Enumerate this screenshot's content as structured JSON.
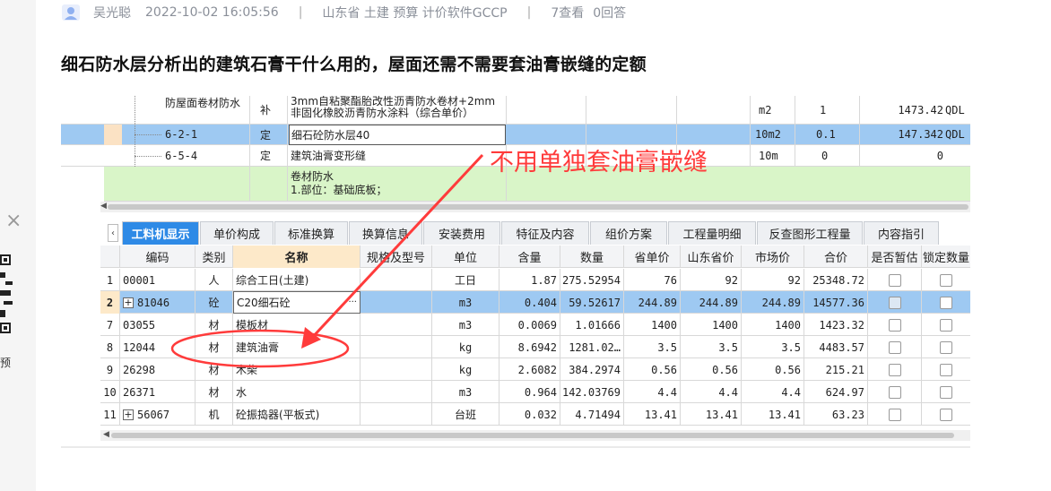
{
  "post": {
    "author": "吴光聪",
    "datetime": "2022-10-02 16:05:56",
    "tags": "山东省  土建  预算  计价软件GCCP",
    "views": "7查看",
    "answers": "0回答",
    "title": "细石防水层分析出的建筑石膏干什么用的，屋面还需不需要套油膏嵌缝的定额"
  },
  "side": {
    "close_glyph": "×",
    "text": "预"
  },
  "annotation": {
    "text": "不用单独套油膏嵌缝",
    "color": "#ff3b3b"
  },
  "upper_rows": [
    {
      "code": "防屋面卷材防水",
      "type": "补",
      "name": "3mm自粘聚酯胎改性沥青防水卷材+2mm非固化橡胶沥青防水涂料（综合单价）",
      "unit": "m2",
      "qty": "1",
      "total": "1473.42",
      "tag": "QDL"
    },
    {
      "code": "6-2-1",
      "type": "定",
      "name": "细石砼防水层40",
      "unit": "10m2",
      "qty": "0.1",
      "total": "147.342",
      "tag": "QDL"
    },
    {
      "code": "6-5-4",
      "type": "定",
      "name": "建筑油膏变形缝",
      "unit": "10m",
      "qty": "0",
      "total": "0",
      "tag": ""
    },
    {
      "code": "",
      "type": "",
      "name": "卷材防水",
      "name2": "1.部位：基础底板；",
      "unit": "",
      "qty": "",
      "total": "",
      "tag": ""
    }
  ],
  "tabs": [
    {
      "label": "工料机显示",
      "active": true
    },
    {
      "label": "单价构成"
    },
    {
      "label": "标准换算"
    },
    {
      "label": "换算信息"
    },
    {
      "label": "安装费用"
    },
    {
      "label": "特征及内容"
    },
    {
      "label": "组价方案"
    },
    {
      "label": "工程量明细"
    },
    {
      "label": "反查图形工程量"
    },
    {
      "label": "内容指引"
    }
  ],
  "grid": {
    "headers": [
      "",
      "编码",
      "类别",
      "名称",
      "规格及型号",
      "单位",
      "含量",
      "数量",
      "省单价",
      "山东省价",
      "市场价",
      "合价",
      "是否暂估",
      "锁定数量"
    ],
    "rows": [
      {
        "no": "1",
        "code": "00001",
        "cat": "人",
        "name": "综合工日(土建)",
        "spec": "",
        "unit": "工日",
        "content": "1.87",
        "qty": "275.52954",
        "prov": "76",
        "sd": "92",
        "market": "92",
        "total": "25348.72",
        "expand": false,
        "sel": false
      },
      {
        "no": "2",
        "code": "81046",
        "cat": "砼",
        "name": "C20细石砼",
        "spec": "",
        "unit": "m3",
        "content": "0.404",
        "qty": "59.52617",
        "prov": "244.89",
        "sd": "244.89",
        "market": "244.89",
        "total": "14577.36",
        "expand": true,
        "sel": true
      },
      {
        "no": "7",
        "code": "03055",
        "cat": "材",
        "name": "模板材",
        "spec": "",
        "unit": "m3",
        "content": "0.0069",
        "qty": "1.01666",
        "prov": "1400",
        "sd": "1400",
        "market": "1400",
        "total": "1423.32",
        "expand": false,
        "sel": false
      },
      {
        "no": "8",
        "code": "12044",
        "cat": "材",
        "name": "建筑油膏",
        "spec": "",
        "unit": "kg",
        "content": "8.6942",
        "qty": "1281.02…",
        "prov": "3.5",
        "sd": "3.5",
        "market": "3.5",
        "total": "4483.57",
        "expand": false,
        "sel": false
      },
      {
        "no": "9",
        "code": "26298",
        "cat": "材",
        "name": "木柴",
        "spec": "",
        "unit": "kg",
        "content": "2.6082",
        "qty": "384.2974",
        "prov": "0.56",
        "sd": "0.56",
        "market": "0.56",
        "total": "215.21",
        "expand": false,
        "sel": false
      },
      {
        "no": "10",
        "code": "26371",
        "cat": "材",
        "name": "水",
        "spec": "",
        "unit": "m3",
        "content": "0.964",
        "qty": "142.03769",
        "prov": "4.4",
        "sd": "4.4",
        "market": "4.4",
        "total": "624.97",
        "expand": false,
        "sel": false
      },
      {
        "no": "11",
        "code": "56067",
        "cat": "机",
        "name": "砼振捣器(平板式)",
        "spec": "",
        "unit": "台班",
        "content": "0.032",
        "qty": "4.71494",
        "prov": "13.41",
        "sd": "13.41",
        "market": "13.41",
        "total": "63.23",
        "expand": true,
        "sel": false
      }
    ]
  }
}
